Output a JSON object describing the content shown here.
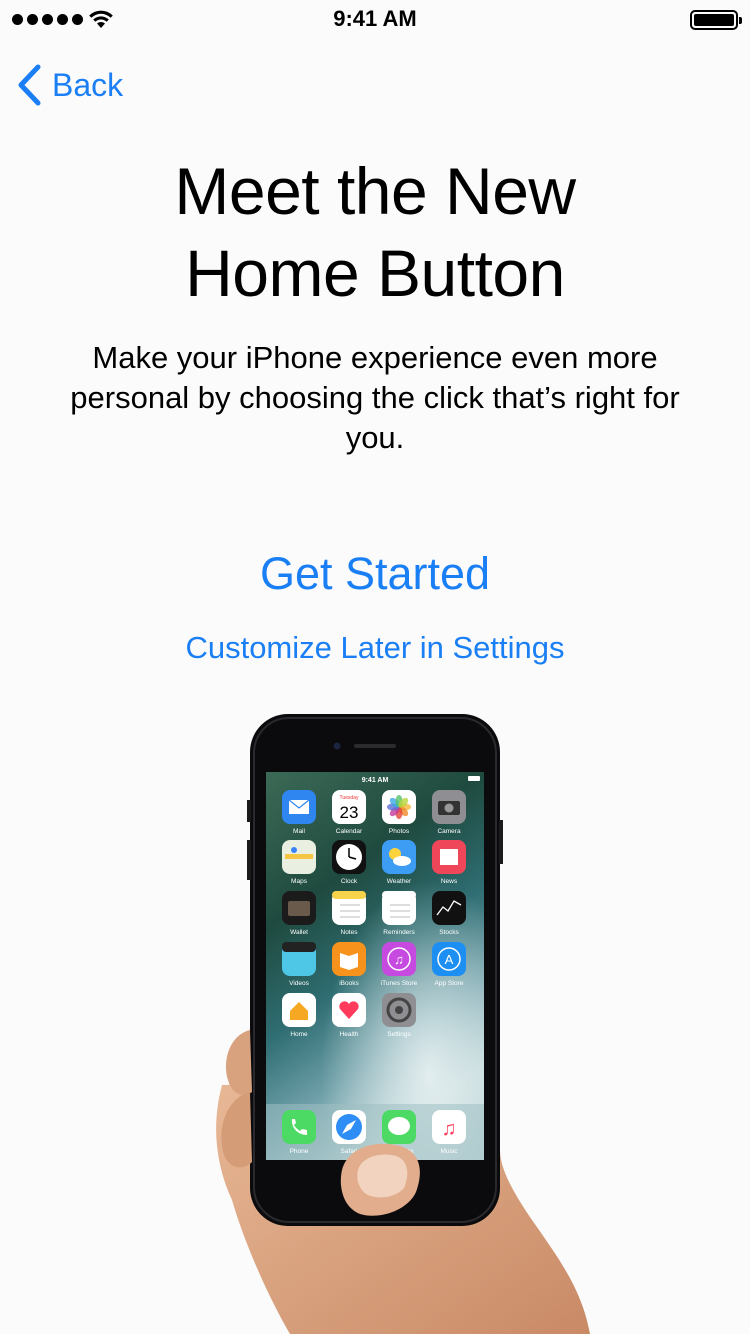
{
  "status_bar": {
    "time": "9:41 AM"
  },
  "nav": {
    "back_label": "Back"
  },
  "header": {
    "title_line1": "Meet the New",
    "title_line2": "Home Button",
    "subtitle": "Make your iPhone experience even more personal by choosing the click that’s right for you."
  },
  "actions": {
    "get_started": "Get Started",
    "customize_later": "Customize Later in Settings"
  },
  "illustration": {
    "phone_time": "9:41 AM",
    "calendar_day": "Tuesday",
    "calendar_date": "23",
    "apps": [
      {
        "label": "Mail",
        "icon": "mail-icon",
        "color": "#2f86f0"
      },
      {
        "label": "Calendar",
        "icon": "calendar-icon",
        "color": "#ffffff"
      },
      {
        "label": "Photos",
        "icon": "photos-icon",
        "color": "#ffffff"
      },
      {
        "label": "Camera",
        "icon": "camera-icon",
        "color": "#8e8e93"
      },
      {
        "label": "Maps",
        "icon": "maps-icon",
        "color": "#e9efe1"
      },
      {
        "label": "Clock",
        "icon": "clock-icon",
        "color": "#111111"
      },
      {
        "label": "Weather",
        "icon": "weather-icon",
        "color": "#3d9df5"
      },
      {
        "label": "News",
        "icon": "news-icon",
        "color": "#f0465a"
      },
      {
        "label": "Wallet",
        "icon": "wallet-icon",
        "color": "#1b1b1b"
      },
      {
        "label": "Notes",
        "icon": "notes-icon",
        "color": "#ffffff"
      },
      {
        "label": "Reminders",
        "icon": "reminders-icon",
        "color": "#ffffff"
      },
      {
        "label": "Stocks",
        "icon": "stocks-icon",
        "color": "#111111"
      },
      {
        "label": "Videos",
        "icon": "videos-icon",
        "color": "#4ec6e6"
      },
      {
        "label": "iBooks",
        "icon": "ibooks-icon",
        "color": "#f7921c"
      },
      {
        "label": "iTunes Store",
        "icon": "itunes-icon",
        "color": "#c64ae0"
      },
      {
        "label": "App Store",
        "icon": "appstore-icon",
        "color": "#1e8ff2"
      },
      {
        "label": "Home",
        "icon": "home-icon",
        "color": "#ffffff"
      },
      {
        "label": "Health",
        "icon": "health-icon",
        "color": "#ffffff"
      },
      {
        "label": "Settings",
        "icon": "settings-icon",
        "color": "#8e8e93"
      }
    ],
    "dock": [
      {
        "label": "Phone",
        "icon": "phone-icon",
        "color": "#4cd964"
      },
      {
        "label": "Safari",
        "icon": "safari-icon",
        "color": "#ffffff"
      },
      {
        "label": "Messages",
        "icon": "messages-icon",
        "color": "#4cd964"
      },
      {
        "label": "Music",
        "icon": "music-icon",
        "color": "#ffffff"
      }
    ]
  },
  "colors": {
    "accent": "#1a7ff5",
    "background": "#fbfbfb"
  }
}
